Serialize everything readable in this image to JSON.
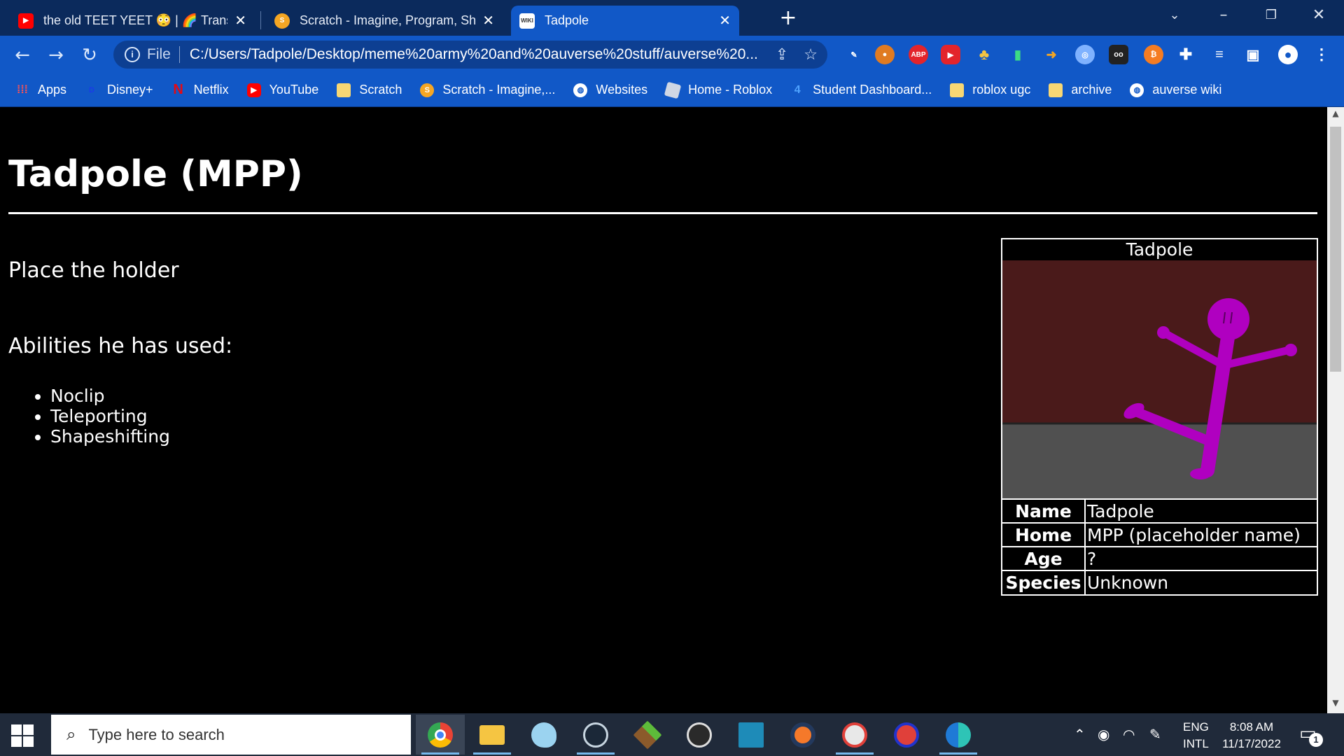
{
  "browser": {
    "tabs": [
      {
        "title": "the old TEET YEET 😳 | 🌈 Trans M",
        "favicon": "youtube-icon"
      },
      {
        "title": "Scratch - Imagine, Program, Share",
        "favicon": "scratch-icon"
      },
      {
        "title": "Tadpole",
        "favicon": "wiki-icon",
        "favicon_text": "WIKI"
      }
    ],
    "address": {
      "scheme": "File",
      "url": "C:/Users/Tadpole/Desktop/meme%20army%20and%20auverse%20stuff/auverse%20..."
    },
    "bookmarks": [
      {
        "label": "Apps",
        "icon": "apps-grid-icon"
      },
      {
        "label": "Disney+",
        "icon": "disney-icon"
      },
      {
        "label": "Netflix",
        "icon": "netflix-icon",
        "icon_text": "N"
      },
      {
        "label": "YouTube",
        "icon": "youtube-icon"
      },
      {
        "label": "Scratch",
        "icon": "folder-icon"
      },
      {
        "label": "Scratch - Imagine,...",
        "icon": "scratch-icon"
      },
      {
        "label": "Websites",
        "icon": "globe-icon"
      },
      {
        "label": "Home - Roblox",
        "icon": "roblox-icon"
      },
      {
        "label": "Student Dashboard...",
        "icon": "dashboard-icon"
      },
      {
        "label": "roblox ugc",
        "icon": "folder-icon"
      },
      {
        "label": "archive",
        "icon": "folder-icon"
      },
      {
        "label": "auverse wiki",
        "icon": "globe-icon"
      }
    ],
    "extensions": {
      "abp_text": "ABP"
    }
  },
  "page": {
    "title": "Tadpole (MPP)",
    "description": "Place the holder",
    "abilities_heading": "Abilities he has used:",
    "abilities": [
      "Noclip",
      "Teleporting",
      "Shapeshifting"
    ],
    "infobox": {
      "title": "Tadpole",
      "rows": [
        {
          "label": "Name",
          "value": "Tadpole"
        },
        {
          "label": "Home",
          "value": "MPP (placeholder name)"
        },
        {
          "label": "Age",
          "value": "?"
        },
        {
          "label": "Species",
          "value": "Unknown"
        }
      ]
    }
  },
  "taskbar": {
    "search_placeholder": "Type here to search",
    "language": {
      "line1": "ENG",
      "line2": "INTL"
    },
    "time": "8:08 AM",
    "date": "11/17/2022",
    "notification_count": "1"
  },
  "colors": {
    "tab_strip": "#0b2a5c",
    "toolbar": "#1158c7",
    "page_bg": "#000000",
    "page_text": "#ffffff",
    "figure_purple": "#b000c0",
    "figure_wall": "#4a1a1a",
    "figure_floor": "#505050"
  }
}
